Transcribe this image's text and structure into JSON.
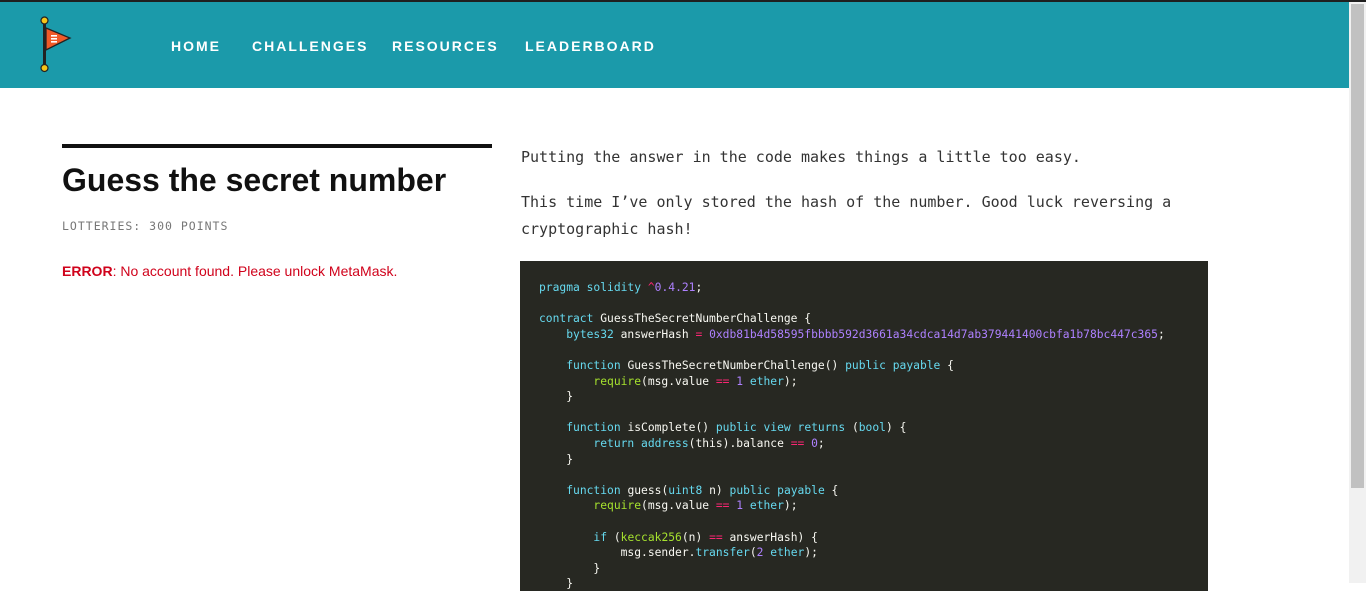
{
  "nav": {
    "logo_icon": "flag-icon",
    "items": [
      {
        "label": "HOME"
      },
      {
        "label": "CHALLENGES"
      },
      {
        "label": "RESOURCES"
      },
      {
        "label": "LEADERBOARD"
      }
    ]
  },
  "challenge": {
    "title": "Guess the secret number",
    "category": "LOTTERIES: 300 POINTS",
    "error_label": "ERROR",
    "error_message": ": No account found. Please unlock MetaMask."
  },
  "description": {
    "paragraph1": "Putting the answer in the code makes things a little too easy.",
    "paragraph2_line1": "This time I’ve only stored the hash of the number. Good luck reversing a",
    "paragraph2_line2": "cryptographic hash!"
  },
  "code": {
    "pragma_version": "0.4.21",
    "contract_name": "GuessTheSecretNumberChallenge",
    "answer_hash": "0xdb81b4d58595fbbbb592d3661a34cdca14d7ab379441400cbfa1b78bc447c365",
    "constructor_name": "GuessTheSecretNumberChallenge",
    "iscomplete_name": "isComplete",
    "guess_name": "guess",
    "value_one": "1",
    "transfer_amount": "2",
    "zero": "0"
  },
  "colors": {
    "navbar": "#1b9aaa",
    "error": "#d0021b",
    "code_bg": "#272822"
  }
}
